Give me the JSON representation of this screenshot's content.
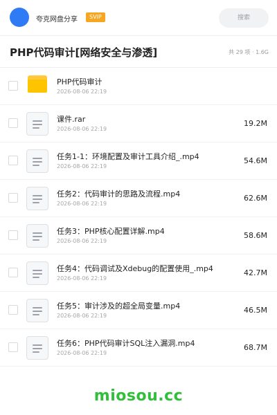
{
  "topbar": {
    "brand": "夸克网盘分享",
    "badge": "SVIP",
    "search_label": "搜索"
  },
  "folder": {
    "title": "PHP代码审计[网络安全与渗透]",
    "summary": "共 29 项 · 1.6G"
  },
  "files": [
    {
      "name": "PHP代码审计",
      "date": "2026-08-06 22:19",
      "size": "",
      "icon": "folder-icon"
    },
    {
      "name": "课件.rar",
      "date": "2026-08-06 22:19",
      "size": "19.2M",
      "icon": "document-icon"
    },
    {
      "name": "任务1-1：环境配置及审计工具介绍_.mp4",
      "date": "2026-08-06 22:19",
      "size": "54.6M",
      "icon": "document-icon"
    },
    {
      "name": "任务2：代码审计的思路及流程.mp4",
      "date": "2026-08-06 22:19",
      "size": "62.6M",
      "icon": "document-icon"
    },
    {
      "name": "任务3：PHP核心配置详解.mp4",
      "date": "2026-08-06 22:19",
      "size": "58.6M",
      "icon": "document-icon"
    },
    {
      "name": "任务4：代码调试及Xdebug的配置使用_.mp4",
      "date": "2026-08-06 22:19",
      "size": "42.7M",
      "icon": "document-icon"
    },
    {
      "name": "任务5：审计涉及的超全局变量.mp4",
      "date": "2026-08-06 22:19",
      "size": "46.5M",
      "icon": "document-icon"
    },
    {
      "name": "任务6：PHP代码审计SQL注入漏洞.mp4",
      "date": "2026-08-06 22:19",
      "size": "68.7M",
      "icon": "document-icon"
    }
  ],
  "watermark": "miosou.cc",
  "colors": {
    "avatar": "#2f7bf5",
    "badge": "#f5a623",
    "folder": "#ffc400",
    "watermark": "#2fbf3b"
  }
}
